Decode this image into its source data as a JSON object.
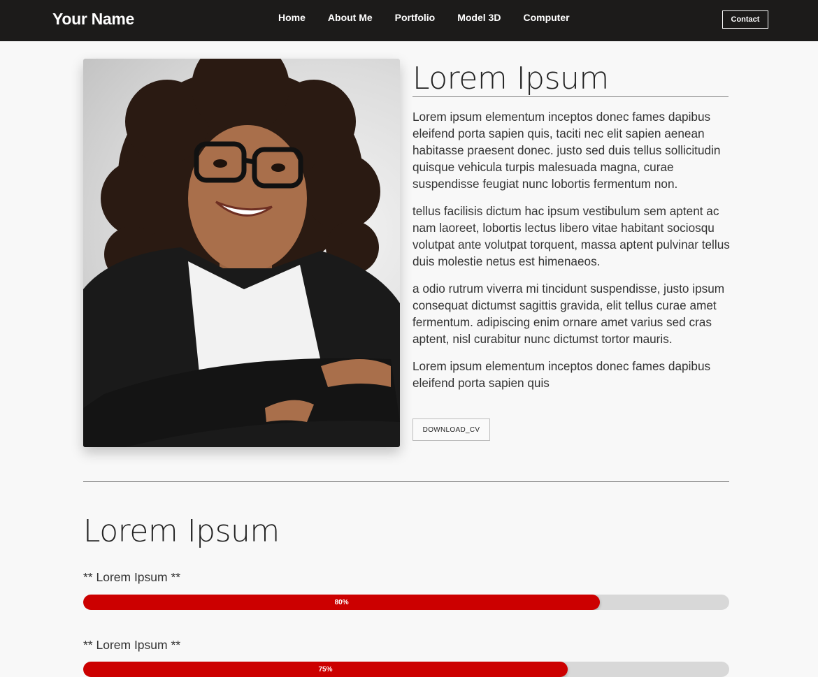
{
  "brand": "Your Name",
  "nav": {
    "items": [
      {
        "label": "Home"
      },
      {
        "label": "About Me"
      },
      {
        "label": "Portfolio"
      },
      {
        "label": "Model 3D"
      },
      {
        "label": "Computer"
      }
    ],
    "contact_label": "Contact"
  },
  "about": {
    "title": "Lorem Ipsum",
    "paragraphs": [
      "Lorem ipsum elementum inceptos donec fames dapibus eleifend porta sapien quis, taciti nec elit sapien aenean habitasse praesent donec. justo sed duis tellus sollicitudin quisque vehicula turpis malesuada magna, curae suspendisse feugiat nunc lobortis fermentum non.",
      "tellus facilisis dictum hac ipsum vestibulum sem aptent ac nam laoreet, lobortis lectus libero vitae habitant sociosqu volutpat ante volutpat torquent, massa aptent pulvinar tellus duis molestie netus est himenaeos.",
      "a odio rutrum viverra mi tincidunt suspendisse, justo ipsum consequat dictumst sagittis gravida, elit tellus curae amet fermentum. adipiscing enim ornare amet varius sed cras aptent, nisl curabitur nunc dictumst tortor mauris.",
      "Lorem ipsum elementum inceptos donec fames dapibus eleifend porta sapien quis"
    ],
    "download_label": "DOWNLOAD_CV"
  },
  "skills": {
    "title": "Lorem Ipsum",
    "items": [
      {
        "label": "** Lorem Ipsum **",
        "percent": 80,
        "percent_label": "80%"
      },
      {
        "label": "** Lorem Ipsum **",
        "percent": 75,
        "percent_label": "75%"
      }
    ]
  },
  "colors": {
    "navbar": "#1c1b1a",
    "accent": "#cc0000",
    "track": "#d8d8d8",
    "background": "#f8f8f8"
  }
}
